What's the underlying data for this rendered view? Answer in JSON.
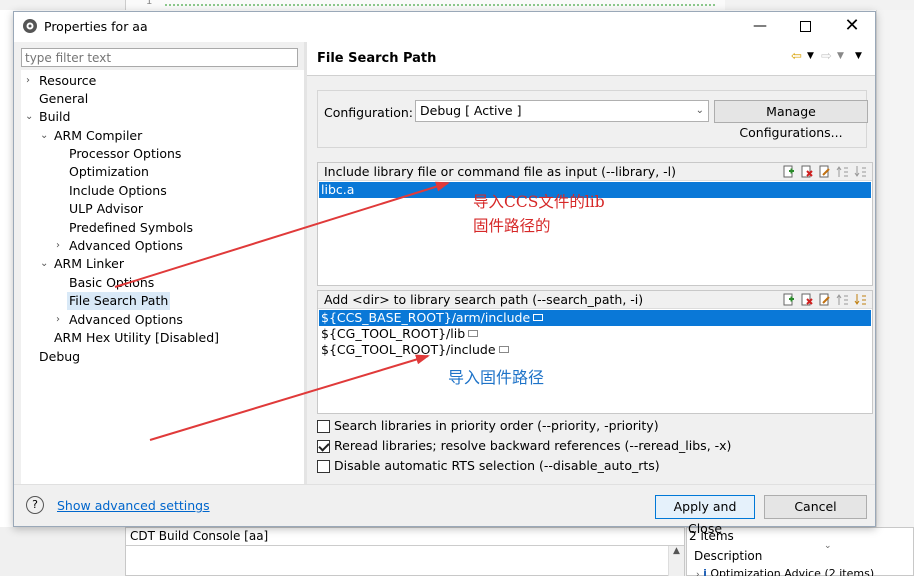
{
  "window": {
    "title": "Properties for aa"
  },
  "filter": {
    "placeholder": "type filter text"
  },
  "tree": [
    {
      "label": "Resource"
    },
    {
      "label": "General"
    },
    {
      "label": "Build"
    },
    {
      "label": "ARM Compiler"
    },
    {
      "label": "Processor Options"
    },
    {
      "label": "Optimization"
    },
    {
      "label": "Include Options"
    },
    {
      "label": "ULP Advisor"
    },
    {
      "label": "Predefined Symbols"
    },
    {
      "label": "Advanced Options"
    },
    {
      "label": "ARM Linker"
    },
    {
      "label": "Basic Options"
    },
    {
      "label": "File Search Path"
    },
    {
      "label": "Advanced Options"
    },
    {
      "label": "ARM Hex Utility  [Disabled]"
    },
    {
      "label": "Debug"
    }
  ],
  "page": {
    "title": "File Search Path"
  },
  "config": {
    "label": "Configuration:",
    "value": "Debug  [ Active ]",
    "manage": "Manage Configurations..."
  },
  "lib_panel": {
    "header": "Include library file or command file as input (--library, -l)",
    "rows": [
      "libc.a"
    ]
  },
  "path_panel": {
    "header": "Add <dir> to library search path (--search_path, -i)",
    "rows": [
      "${CCS_BASE_ROOT}/arm/include",
      "${CG_TOOL_ROOT}/lib",
      "${CG_TOOL_ROOT}/include"
    ]
  },
  "options": [
    {
      "label": "Search libraries in priority order (--priority, -priority)",
      "checked": false
    },
    {
      "label": "Reread libraries; resolve backward references (--reread_libs, -x)",
      "checked": true
    },
    {
      "label": "Disable automatic RTS selection (--disable_auto_rts)",
      "checked": false
    }
  ],
  "footer": {
    "help": "?",
    "advanced": "Show advanced settings",
    "apply": "Apply and Close",
    "cancel": "Cancel"
  },
  "annotations": {
    "a1_line1": "导入CCS文件的lib",
    "a1_line2": "固件路径的",
    "a2": "导入固件路径"
  },
  "background": {
    "console_tab": "CDT Build Console [aa]",
    "items": "2 items",
    "description": "Description",
    "row": "Optimization Advice (2 items)",
    "line_no": "1"
  },
  "colors": {
    "selection": "#0a78d7",
    "tree_selection": "#d9e9f7",
    "annotation_red": "#d62828",
    "annotation_blue": "#1e73c8"
  }
}
